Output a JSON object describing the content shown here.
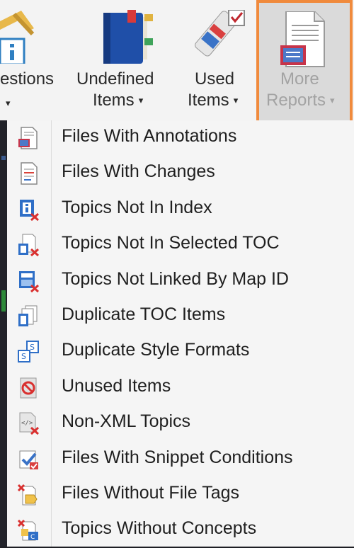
{
  "ribbon": {
    "questions": {
      "line1": "estions",
      "caret": "▾"
    },
    "undefined_items": {
      "line1": "Undefined",
      "line2": "Items",
      "caret": "▾"
    },
    "used_items": {
      "line1": "Used",
      "line2": "Items",
      "caret": "▾"
    },
    "more_reports": {
      "line1": "More",
      "line2": "Reports",
      "caret": "▾",
      "state": "disabled-highlighted"
    }
  },
  "menu": {
    "items": [
      {
        "label": "Files With Annotations",
        "icon": "file-annotations-icon"
      },
      {
        "label": "Files With Changes",
        "icon": "file-changes-icon"
      },
      {
        "label": "Topics Not In Index",
        "icon": "topic-not-in-index-icon"
      },
      {
        "label": "Topics Not In Selected TOC",
        "icon": "topic-not-in-toc-icon"
      },
      {
        "label": "Topics Not Linked By Map ID",
        "icon": "topic-not-linked-icon"
      },
      {
        "label": "Duplicate TOC Items",
        "icon": "duplicate-toc-icon"
      },
      {
        "label": "Duplicate Style Formats",
        "icon": "duplicate-styles-icon"
      },
      {
        "label": "Unused Items",
        "icon": "unused-items-icon"
      },
      {
        "label": "Non-XML Topics",
        "icon": "non-xml-icon"
      },
      {
        "label": "Files With Snippet Conditions",
        "icon": "snippet-conditions-icon"
      },
      {
        "label": "Files Without File Tags",
        "icon": "no-file-tags-icon"
      },
      {
        "label": "Topics Without Concepts",
        "icon": "no-concepts-icon"
      }
    ]
  },
  "colors": {
    "highlight_border": "#f08a3c",
    "menu_bg": "#f5f5f5",
    "ribbon_bg": "#f3f3f3",
    "disabled_text": "#a3a3a3"
  }
}
